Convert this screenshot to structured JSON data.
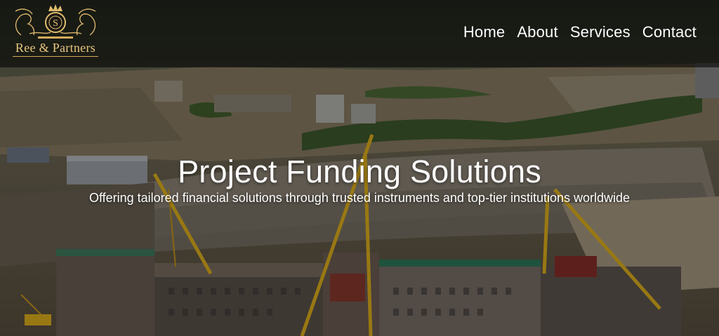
{
  "brand": {
    "name": "Ree & Partners",
    "colors": {
      "gold": "#e8c77c",
      "header_bg": "#000000"
    }
  },
  "nav": {
    "items": [
      {
        "label": "Home"
      },
      {
        "label": "About"
      },
      {
        "label": "Services"
      },
      {
        "label": "Contact"
      }
    ]
  },
  "hero": {
    "title": "Project Funding Solutions",
    "subtitle": "Offering tailored financial solutions through trusted instruments and top-tier institutions worldwide"
  }
}
